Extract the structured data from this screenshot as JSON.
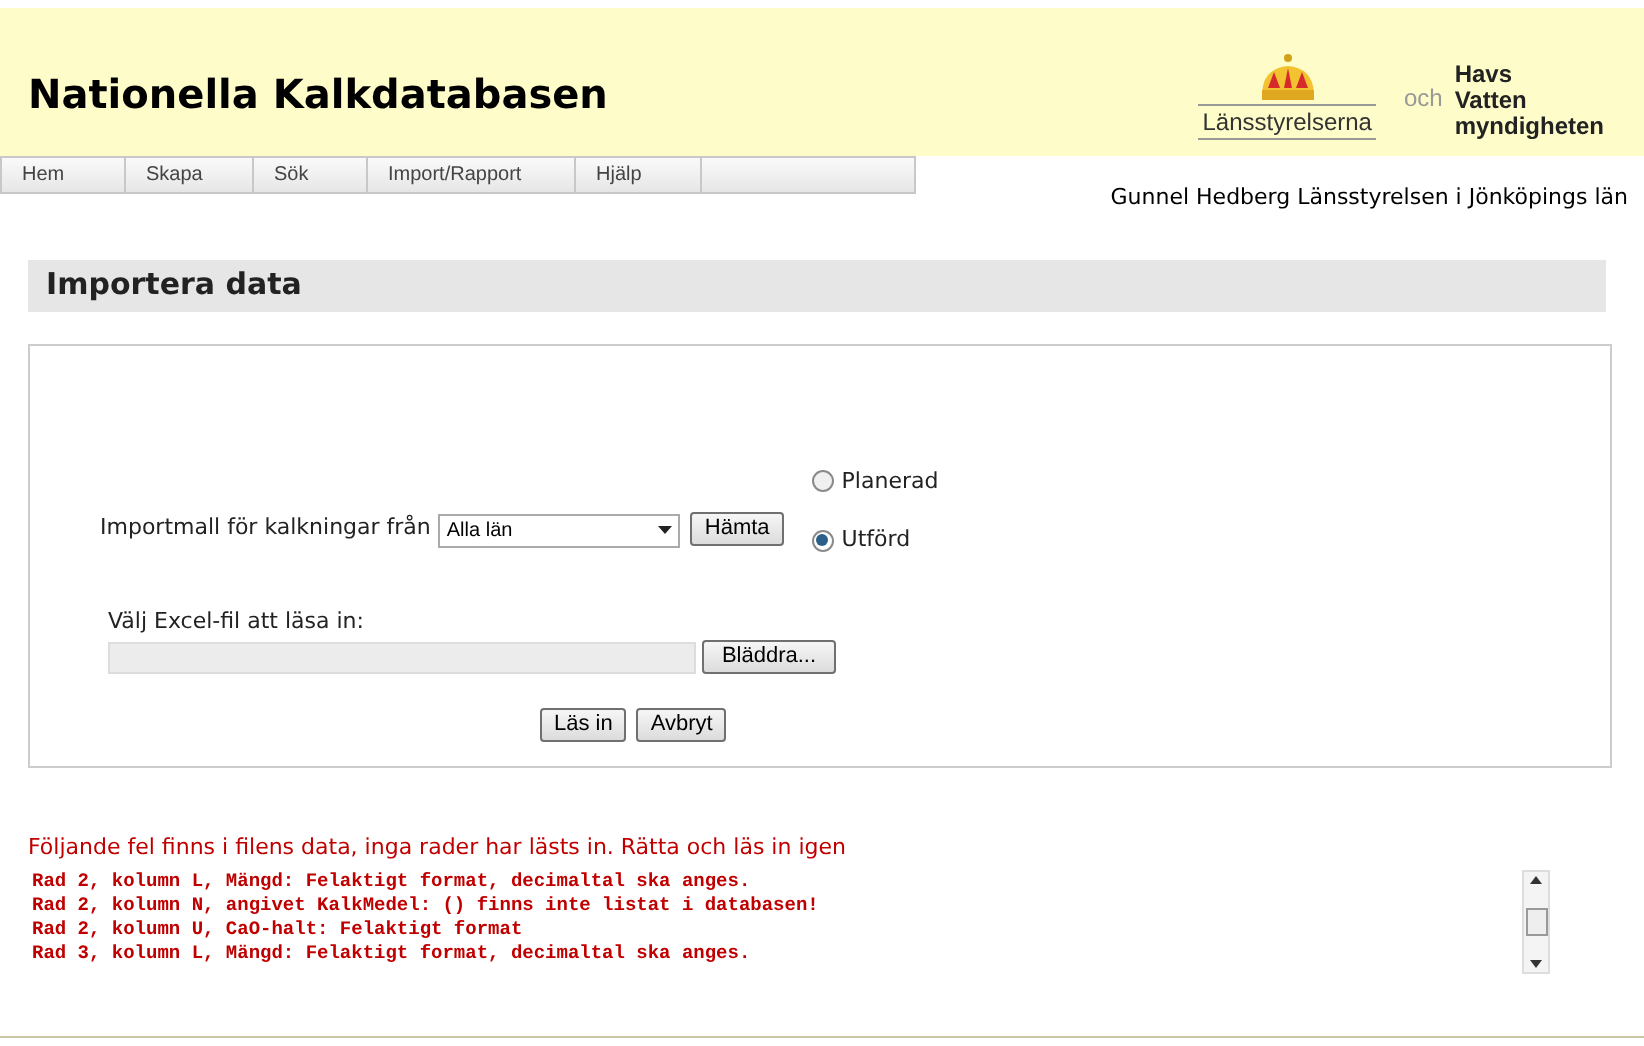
{
  "header": {
    "title": "Nationella Kalkdatabasen",
    "logo_left": "Länsstyrelserna",
    "logo_joiner": "och",
    "logo_right": [
      "Havs",
      "Vatten",
      "myndigheten"
    ]
  },
  "nav": [
    {
      "label": "Hem"
    },
    {
      "label": "Skapa"
    },
    {
      "label": "Sök"
    },
    {
      "label": "Import/Rapport"
    },
    {
      "label": "Hjälp"
    }
  ],
  "user": "Gunnel Hedberg Länsstyrelsen i Jönköpings län",
  "page_title": "Importera data",
  "form": {
    "template_label": "Importmall för kalkningar från",
    "template_select": "Alla län",
    "fetch_button": "Hämta",
    "radios": [
      {
        "label": "Planerad",
        "selected": false
      },
      {
        "label": "Utförd",
        "selected": true
      }
    ],
    "file_label": "Välj Excel-fil att läsa in:",
    "browse_button": "Bläddra...",
    "buttons": [
      "Läs in",
      "Avbryt"
    ]
  },
  "errors": {
    "heading": "Följande fel finns i filens data, inga rader har lästs in. Rätta och läs in igen",
    "lines": [
      "Rad 2, kolumn L, Mängd: Felaktigt format, decimaltal ska anges.",
      "Rad 2, kolumn N, angivet KalkMedel: () finns inte listat i databasen!",
      "Rad 2, kolumn U, CaO-halt: Felaktigt format",
      "Rad 3, kolumn L, Mängd: Felaktigt format, decimaltal ska anges."
    ]
  }
}
